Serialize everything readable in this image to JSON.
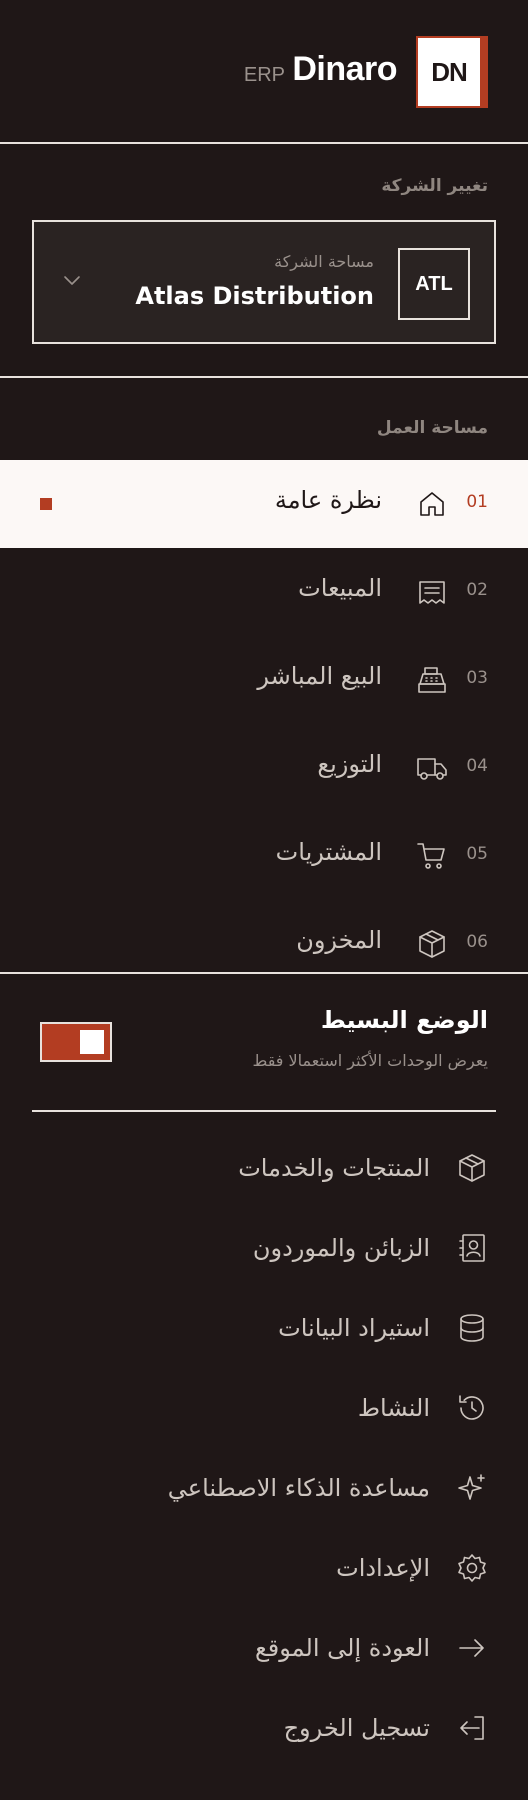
{
  "brand": {
    "initials": "DN",
    "name": "Dinaro",
    "tag": "ERP"
  },
  "company": {
    "section_label": "تغيير الشركة",
    "logo": "ATL",
    "subtitle": "مساحة الشركة",
    "name": "Atlas Distribution"
  },
  "workspace": {
    "section_label": "مساحة العمل",
    "items": [
      {
        "num": "01",
        "label": "نظرة عامة",
        "icon": "home-icon",
        "active": true
      },
      {
        "num": "02",
        "label": "المبيعات",
        "icon": "receipt-icon"
      },
      {
        "num": "03",
        "label": "البيع المباشر",
        "icon": "cash-register-icon"
      },
      {
        "num": "04",
        "label": "التوزيع",
        "icon": "truck-icon"
      },
      {
        "num": "05",
        "label": "المشتريات",
        "icon": "cart-icon"
      },
      {
        "num": "06",
        "label": "المخزون",
        "icon": "box-icon"
      }
    ]
  },
  "simple_mode": {
    "title": "الوضع البسيط",
    "subtitle": "يعرض الوحدات الأكثر استعمالا فقط",
    "enabled": true
  },
  "menu": [
    {
      "label": "المنتجات والخدمات",
      "icon": "package-icon"
    },
    {
      "label": "الزبائن والموردون",
      "icon": "contacts-icon"
    },
    {
      "label": "استيراد البيانات",
      "icon": "database-icon"
    },
    {
      "label": "النشاط",
      "icon": "history-icon"
    },
    {
      "label": "مساعدة الذكاء الاصطناعي",
      "icon": "sparkles-icon"
    },
    {
      "label": "الإعدادات",
      "icon": "gear-icon"
    },
    {
      "label": "العودة إلى الموقع",
      "icon": "arrow-right-icon"
    },
    {
      "label": "تسجيل الخروج",
      "icon": "logout-icon"
    }
  ],
  "colors": {
    "background": "#1f1717",
    "accent": "#b33d22",
    "active_bg": "#fcf8f6",
    "text": "#e8e2dd",
    "muted": "#9a918c"
  }
}
